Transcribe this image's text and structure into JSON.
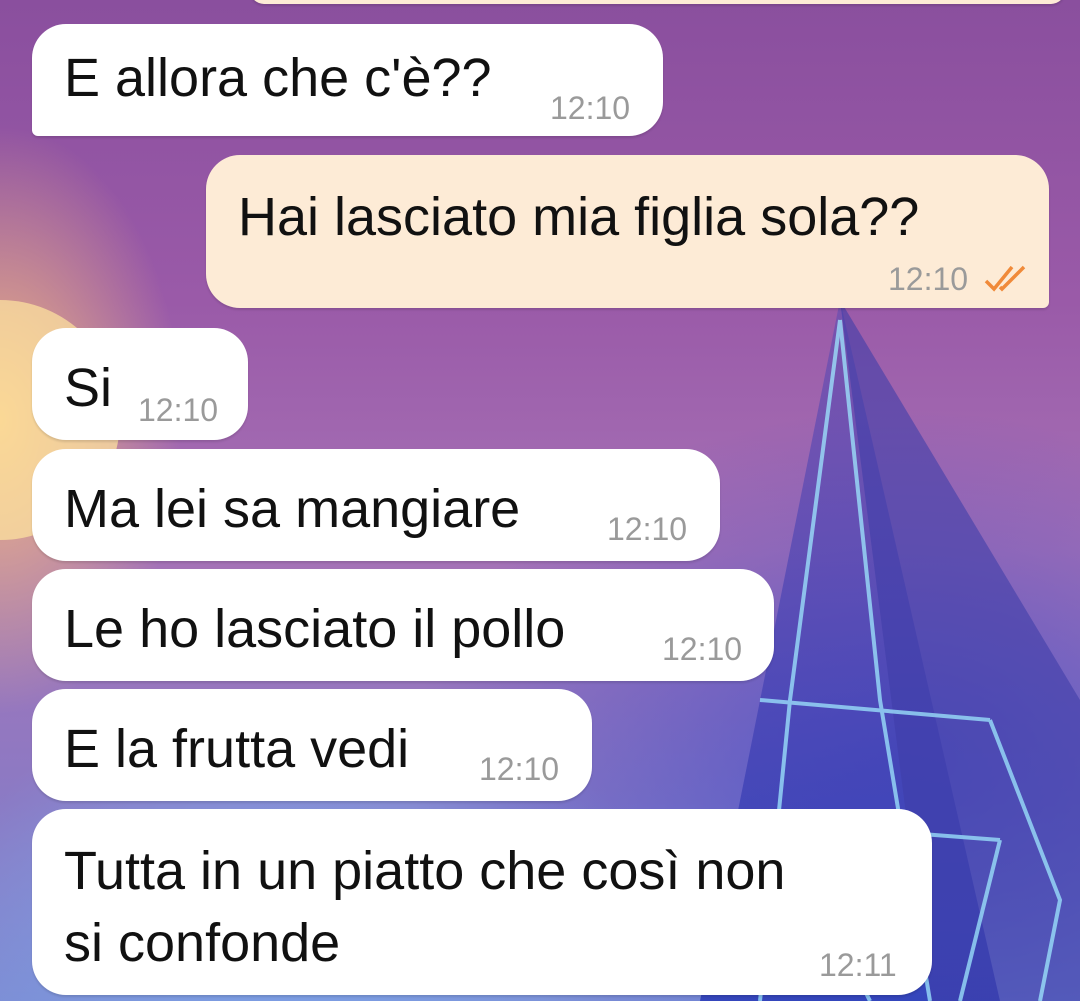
{
  "colors": {
    "incoming_bubble": "#ffffff",
    "outgoing_bubble": "#fdebd6",
    "read_receipt": "#f08a3a",
    "timestamp": "#9a9a9a"
  },
  "messages": [
    {
      "direction": "incoming",
      "text": "E allora che c'è??",
      "time": "12:10"
    },
    {
      "direction": "outgoing",
      "text": "Hai lasciato mia figlia sola??",
      "time": "12:10",
      "status": "read-double-check-icon"
    },
    {
      "direction": "incoming",
      "text": "Si",
      "time": "12:10"
    },
    {
      "direction": "incoming",
      "text": "Ma lei sa mangiare",
      "time": "12:10"
    },
    {
      "direction": "incoming",
      "text": "Le ho lasciato il pollo",
      "time": "12:10"
    },
    {
      "direction": "incoming",
      "text": "E la frutta vedi",
      "time": "12:10"
    },
    {
      "direction": "incoming",
      "text_line1": "Tutta in un piatto che così non",
      "text_line2": "si confonde",
      "time": "12:11"
    }
  ]
}
